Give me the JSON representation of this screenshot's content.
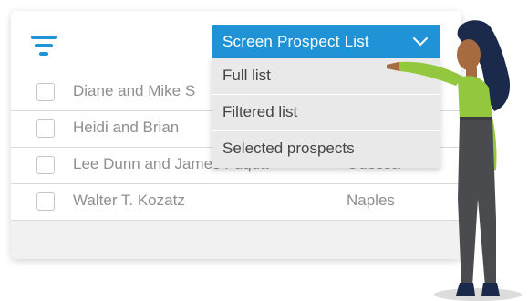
{
  "dropdown": {
    "label": "Screen Prospect List",
    "icon": "chevron-down-icon",
    "options": [
      "Full list",
      "Filtered list",
      "Selected prospects"
    ]
  },
  "toolbar": {
    "filter_icon": "filter-icon"
  },
  "prospects": [
    {
      "name": "Diane and Mike S",
      "city": ""
    },
    {
      "name": "Heidi and Brian",
      "city": ""
    },
    {
      "name": "Lee Dunn and James Fuqua",
      "city": "Odessa"
    },
    {
      "name": "Walter T. Kozatz",
      "city": "Naples"
    }
  ],
  "colors": {
    "accent": "#1f93d6",
    "menu_bg": "#e9e9e9",
    "row_text": "#8f8f8f",
    "skin": "#a76b42",
    "hair": "#1b2a4a",
    "top": "#93c83e",
    "pants": "#4a4b4e"
  }
}
